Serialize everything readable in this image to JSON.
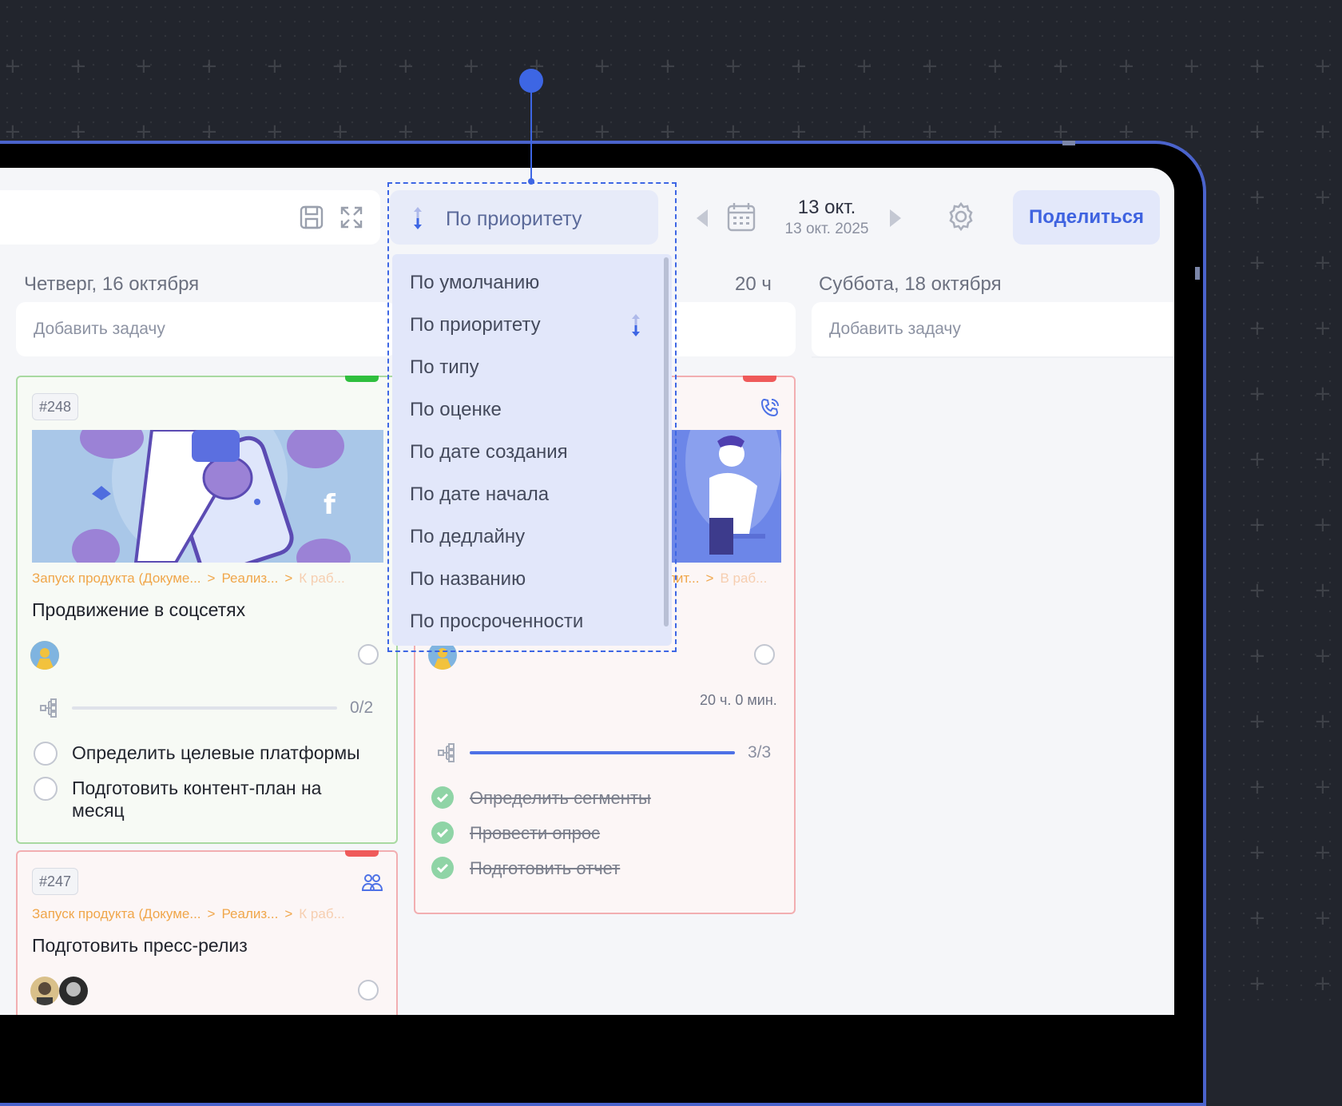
{
  "toolbar": {
    "sort_label": "По приоритету",
    "date_main": "13 окт.",
    "date_sub": "13 окт. 2025",
    "share_label": "Поделиться"
  },
  "sort_menu": {
    "items": [
      "По умолчанию",
      "По приоритету",
      "По типу",
      "По оценке",
      "По дате создания",
      "По дате начала",
      "По дедлайну",
      "По названию",
      "По просроченности"
    ],
    "selected": "По приоритету"
  },
  "columns": {
    "thursday": {
      "title": "Четверг, 16 октября",
      "add_task": "Добавить задачу"
    },
    "friday": {
      "hours": "20 ч"
    },
    "saturday": {
      "title": "Суббота, 18 октября",
      "add_task": "Добавить задачу"
    }
  },
  "cards": {
    "c248": {
      "id": "#248",
      "crumb1": "Запуск продукта (Докуме...",
      "crumb2": "Реализ...",
      "crumb3": "К раб...",
      "title": "Продвижение в соцсетях",
      "progress_label": "0/2",
      "progress": 0.0,
      "subtasks": [
        "Определить целевые платформы",
        "Подготовить контент-план на месяц"
      ]
    },
    "c247": {
      "id": "#247",
      "crumb1": "Запуск продукта (Докуме...",
      "crumb2": "Реализ...",
      "crumb3": "К раб...",
      "title": "Подготовить пресс-релиз"
    },
    "cmid": {
      "crumb2": "лит...",
      "crumb3": "В раб...",
      "time": "20 ч. 0 мин.",
      "progress_label": "3/3",
      "progress": 1.0,
      "subtasks": [
        "Определить сегменты",
        "Провести опрос",
        "Подготовить отчет"
      ]
    }
  },
  "colors": {
    "accent": "#3d66e4",
    "priority_high": "#ef5a5a",
    "priority_low": "#2fbf3e",
    "crumb": "#f0a64a"
  }
}
